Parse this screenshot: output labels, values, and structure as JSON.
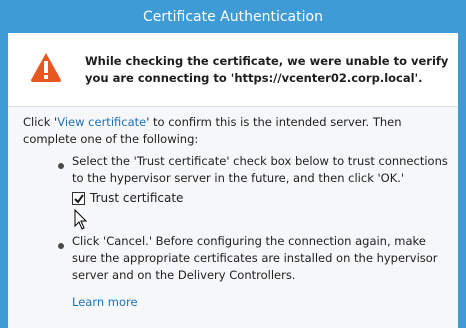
{
  "window": {
    "title": "Certificate Authentication"
  },
  "header": {
    "icon": "warning-icon",
    "message": "While checking the certificate, we were unable to verify you are connecting to 'https://vcenter02.corp.local'."
  },
  "content": {
    "intro_before": "Click '",
    "intro_link": "View certificate",
    "intro_after": "' to confirm this is the intended server. Then complete one of the following:",
    "bullet1": "Select the 'Trust certificate' check box below to trust connections to the hypervisor server in the future, and then click 'OK.'",
    "trust_checkbox": {
      "label": "Trust certificate",
      "checked": true
    },
    "bullet2": "Click 'Cancel.' Before configuring the connection again, make sure the appropriate certificates are installed on the hypervisor server and on the Delivery Controllers.",
    "learn_more": "Learn more"
  },
  "colors": {
    "titlebar": "#3e9bd6",
    "link": "#1a73b8",
    "warning": "#e8571f"
  }
}
